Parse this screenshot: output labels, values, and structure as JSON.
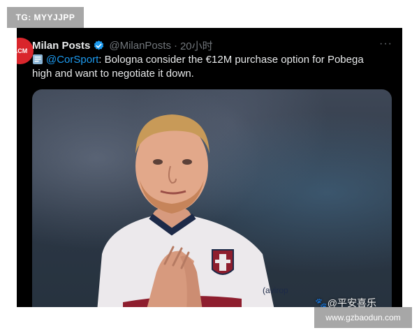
{
  "overlay_tag": "TG: MYYJJPP",
  "tweet": {
    "author_name": "Milan Posts",
    "handle": "@MilanPosts",
    "time_separator": "·",
    "time_ago": "20小时",
    "more_label": "···",
    "mention": "@CorSport",
    "text": ": Bologna consider the €12M purchase option for Pobega high and want to negotiate it down.",
    "media_watermark": "🐾@平安喜乐"
  },
  "site_watermark": "www.gzbaodun.com",
  "colors": {
    "tweet_background": "#000000",
    "accent_blue": "#1d9bf0",
    "text_primary": "#e7e9ea",
    "text_secondary": "#71767b",
    "avatar_red": "#d9262c",
    "overlay_gray": "#a7a7a7"
  },
  "icons": [
    "verified-badge-icon",
    "document-icon",
    "more-icon",
    "paw-icon"
  ]
}
